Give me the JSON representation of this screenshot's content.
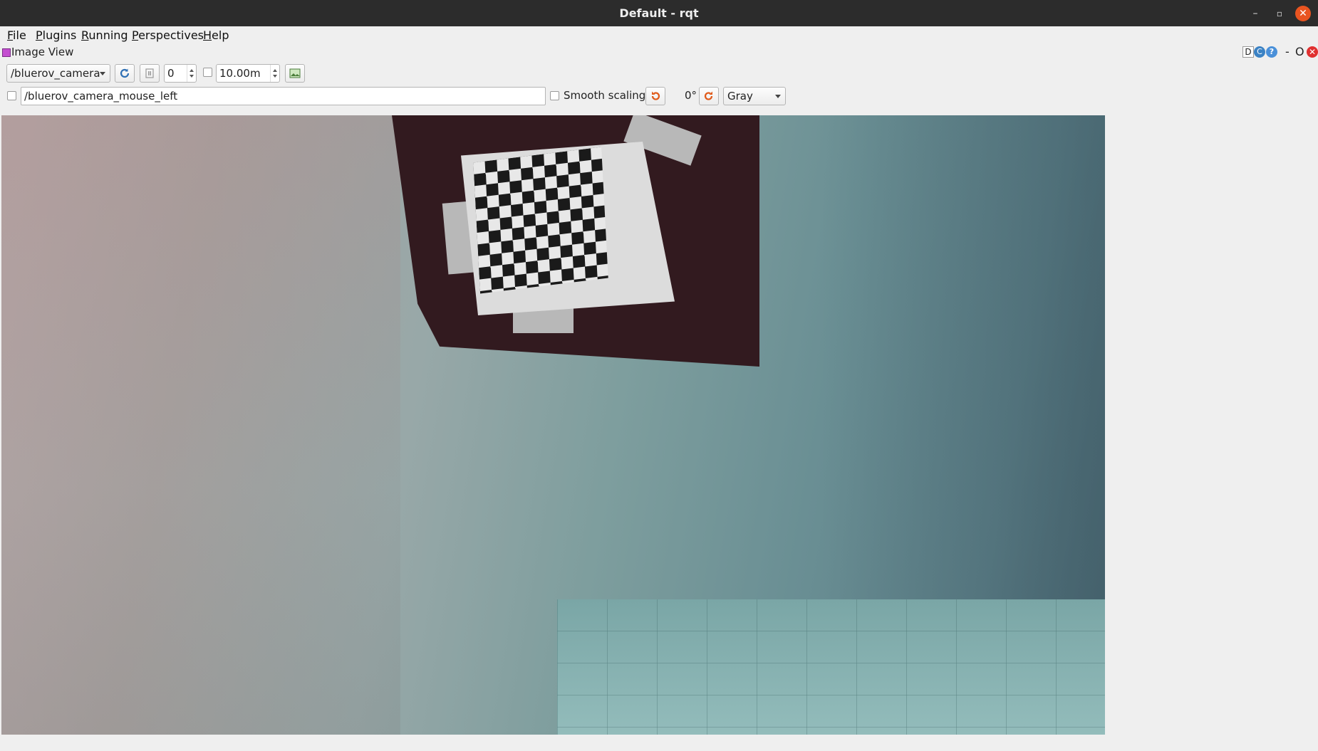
{
  "window": {
    "title": "Default - rqt",
    "minimize": "–",
    "maximize": "▫",
    "close": "✕"
  },
  "menu": {
    "items": [
      "File",
      "Plugins",
      "Running",
      "Perspectives",
      "Help"
    ]
  },
  "dock": {
    "title": "Image View",
    "buttons": {
      "d": "D",
      "reload": "C",
      "help": "?",
      "minimize": "-",
      "float": "O",
      "close": "✕"
    }
  },
  "toolbar": {
    "topic_selected": "/bluerov_camera",
    "refresh_icon": "refresh-icon",
    "pause_icon": "pause-icon",
    "zoom_value": "0",
    "max_range_value": "10.00m",
    "save_icon": "save-image-icon"
  },
  "toolbar2": {
    "mouse_topic": "/bluerov_camera_mouse_left",
    "smooth_scaling_label": "Smooth scaling",
    "rotate_left_icon": "rotate-ccw-icon",
    "rotation_value": "0°",
    "rotate_right_icon": "rotate-cw-icon",
    "colormap_selected": "Gray"
  },
  "image": {
    "description_icon": "camera-frame",
    "colors": {
      "board": "#321a1f",
      "water": "#6a8f94"
    }
  }
}
